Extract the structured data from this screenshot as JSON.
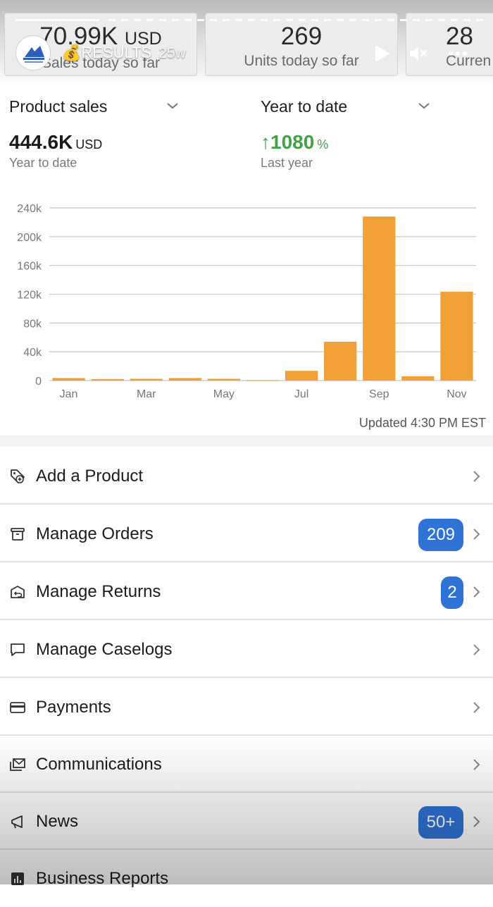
{
  "metrics": {
    "card1": {
      "value": "70.99K",
      "unit": "USD",
      "label": "Sales today so far"
    },
    "card2": {
      "value": "269",
      "label": "Units today so far"
    },
    "card3": {
      "value": "28",
      "label": "Curren"
    }
  },
  "story": {
    "title": "💰RESULTS",
    "age": "25w",
    "progress": 0.18,
    "icons": {
      "play": "play-icon",
      "mute": "mute-icon",
      "more": "more-icon"
    }
  },
  "summary": {
    "left_selector": "Product sales",
    "right_selector": "Year to date",
    "left_value": "444.6K",
    "left_unit": "USD",
    "left_caption": "Year to date",
    "right_arrow": "↑",
    "right_value": "1080",
    "right_unit": "%",
    "right_caption": "Last year",
    "colors": {
      "positive": "#43a047",
      "bar": "#f0a035",
      "badge": "#2f73d6"
    }
  },
  "chart_data": {
    "type": "bar",
    "categories": [
      "Jan",
      "Feb",
      "Mar",
      "Apr",
      "May",
      "Jun",
      "Jul",
      "Aug",
      "Sep",
      "Oct",
      "Nov"
    ],
    "tick_labels": [
      "Jan",
      "",
      "Mar",
      "",
      "May",
      "",
      "Jul",
      "",
      "Sep",
      "",
      "Nov"
    ],
    "values": [
      3500,
      2000,
      2500,
      3500,
      2500,
      500,
      13500,
      54000,
      228000,
      6000,
      123500
    ],
    "ylim": [
      0,
      240000
    ],
    "yticks": [
      0,
      40000,
      80000,
      120000,
      160000,
      200000,
      240000
    ],
    "ytick_labels": [
      "0",
      "40k",
      "80k",
      "120k",
      "160k",
      "200k",
      "240k"
    ],
    "grid": true,
    "title": "",
    "xlabel": "",
    "ylabel": ""
  },
  "updated": "Updated 4:30 PM EST",
  "menu": [
    {
      "label": "Add a Product",
      "icon": "tag-add-icon"
    },
    {
      "label": "Manage Orders",
      "icon": "box-icon",
      "badge": "209"
    },
    {
      "label": "Manage Returns",
      "icon": "return-box-icon",
      "badge": "2"
    },
    {
      "label": "Manage Caselogs",
      "icon": "chat-icon"
    },
    {
      "label": "Payments",
      "icon": "card-icon"
    },
    {
      "label": "Communications",
      "icon": "mail-icon"
    },
    {
      "label": "News",
      "icon": "megaphone-icon",
      "badge": "50+"
    },
    {
      "label": "Business Reports",
      "icon": "bar-chart-icon"
    }
  ]
}
